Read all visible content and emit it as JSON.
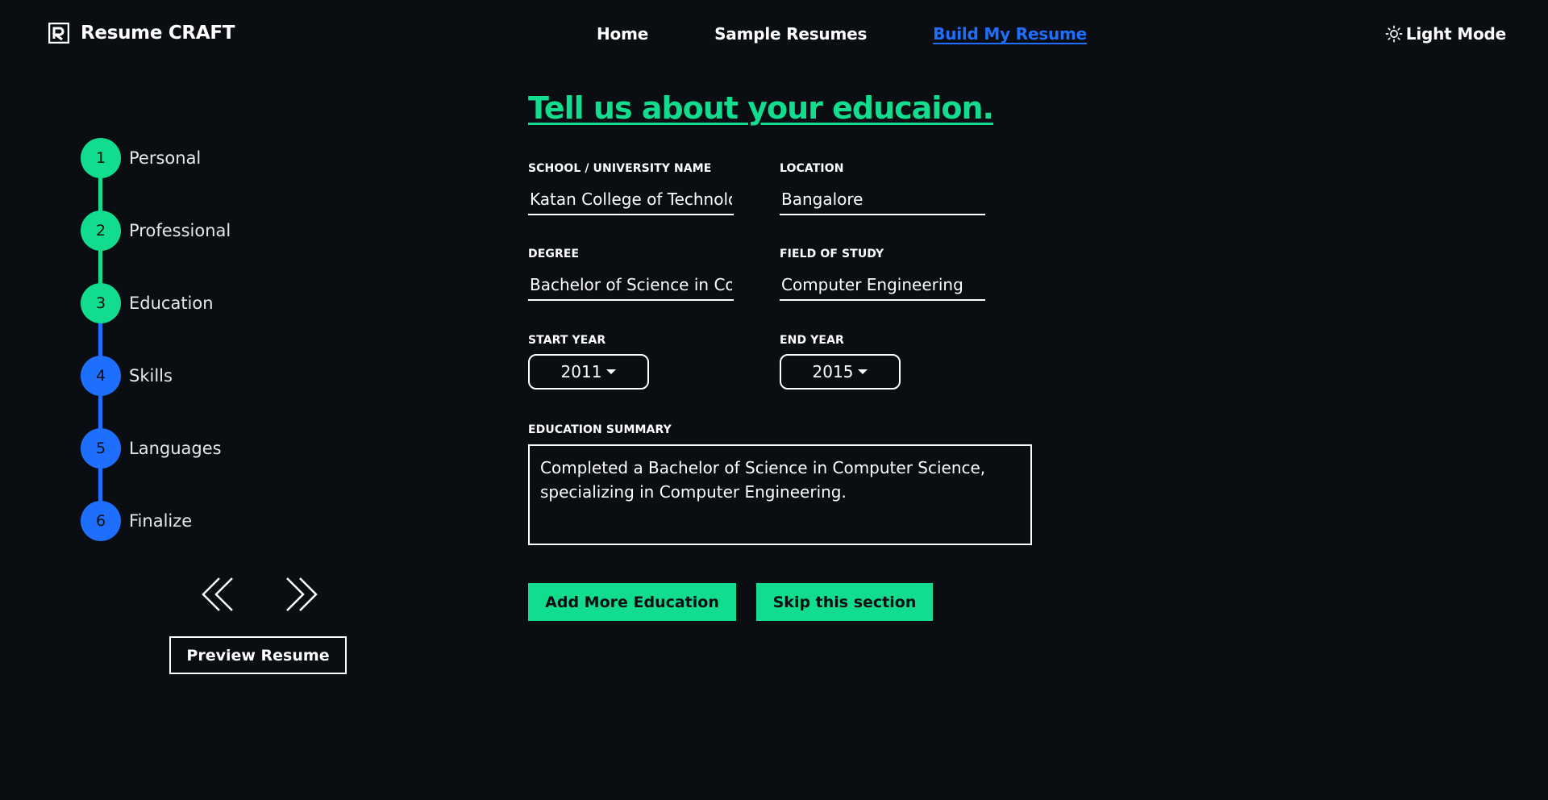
{
  "header": {
    "brand": "Resume CRAFT",
    "nav": [
      {
        "label": "Home"
      },
      {
        "label": "Sample Resumes"
      },
      {
        "label": "Build My Resume",
        "active": true
      }
    ],
    "mode_toggle": "Light Mode",
    "mode_icon": "sun-icon"
  },
  "colors": {
    "background": "#0a0d12",
    "accent_green": "#12dc8e",
    "accent_blue": "#1f6fff",
    "text": "#ffffff"
  },
  "stepper": {
    "steps": [
      {
        "number": "1",
        "label": "Personal",
        "status": "complete"
      },
      {
        "number": "2",
        "label": "Professional",
        "status": "complete"
      },
      {
        "number": "3",
        "label": "Education",
        "status": "current"
      },
      {
        "number": "4",
        "label": "Skills",
        "status": "pending"
      },
      {
        "number": "5",
        "label": "Languages",
        "status": "pending"
      },
      {
        "number": "6",
        "label": "Finalize",
        "status": "pending"
      }
    ],
    "prev_icon": "double-chevron-left-icon",
    "next_icon": "double-chevron-right-icon",
    "preview_button": "Preview Resume"
  },
  "form": {
    "title": "Tell us about your educaion.",
    "school": {
      "label": "SCHOOL / UNIVERSITY NAME",
      "value": "Katan College of Technology"
    },
    "location": {
      "label": "LOCATION",
      "value": "Bangalore"
    },
    "degree": {
      "label": "DEGREE",
      "value": "Bachelor of Science in Computer Science"
    },
    "field_of_study": {
      "label": "FIELD OF STUDY",
      "value": "Computer Engineering"
    },
    "start_year": {
      "label": "START YEAR",
      "value": "2011"
    },
    "end_year": {
      "label": "END YEAR",
      "value": "2015"
    },
    "summary": {
      "label": "EDUCATION SUMMARY",
      "value": "Completed a Bachelor of Science in Computer Science, specializing in Computer Engineering."
    },
    "add_more_button": "Add More Education",
    "skip_button": "Skip this section"
  }
}
